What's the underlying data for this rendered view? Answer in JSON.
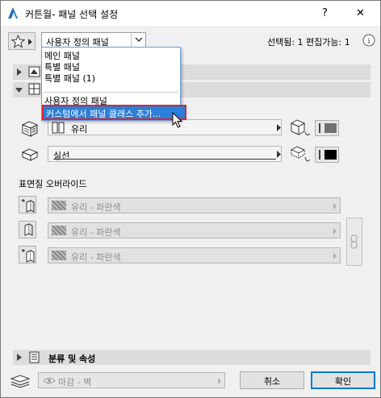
{
  "window": {
    "title": "커튼월- 패널 선택 설정",
    "help": "?",
    "close": "✕"
  },
  "panel_select": {
    "selected_value": "사용자 정의 패널",
    "status": "선택됨: 1 편집가능: 1",
    "menu_items": [
      "메인 패널",
      "특별 패널",
      "특별 패널 (1)"
    ],
    "menu_custom_item": "사용자 정의 패널",
    "menu_action": "커스텀에서 패널 클래스 추가..."
  },
  "material": {
    "surface_value": "유리",
    "line_value": "실선"
  },
  "override": {
    "heading": "표면질 오버라이드",
    "rows": [
      "유리 - 파란색",
      "유리 - 파란색",
      "유리 - 파란색"
    ]
  },
  "classification": {
    "label": "분류 및 속성"
  },
  "footer": {
    "layer_value": "마감 - 벽",
    "cancel": "취소",
    "ok": "확인"
  },
  "colors": {
    "accent": "#2a7fd8",
    "highlight_border": "#e0232f",
    "bg": "#f0f0f0"
  }
}
